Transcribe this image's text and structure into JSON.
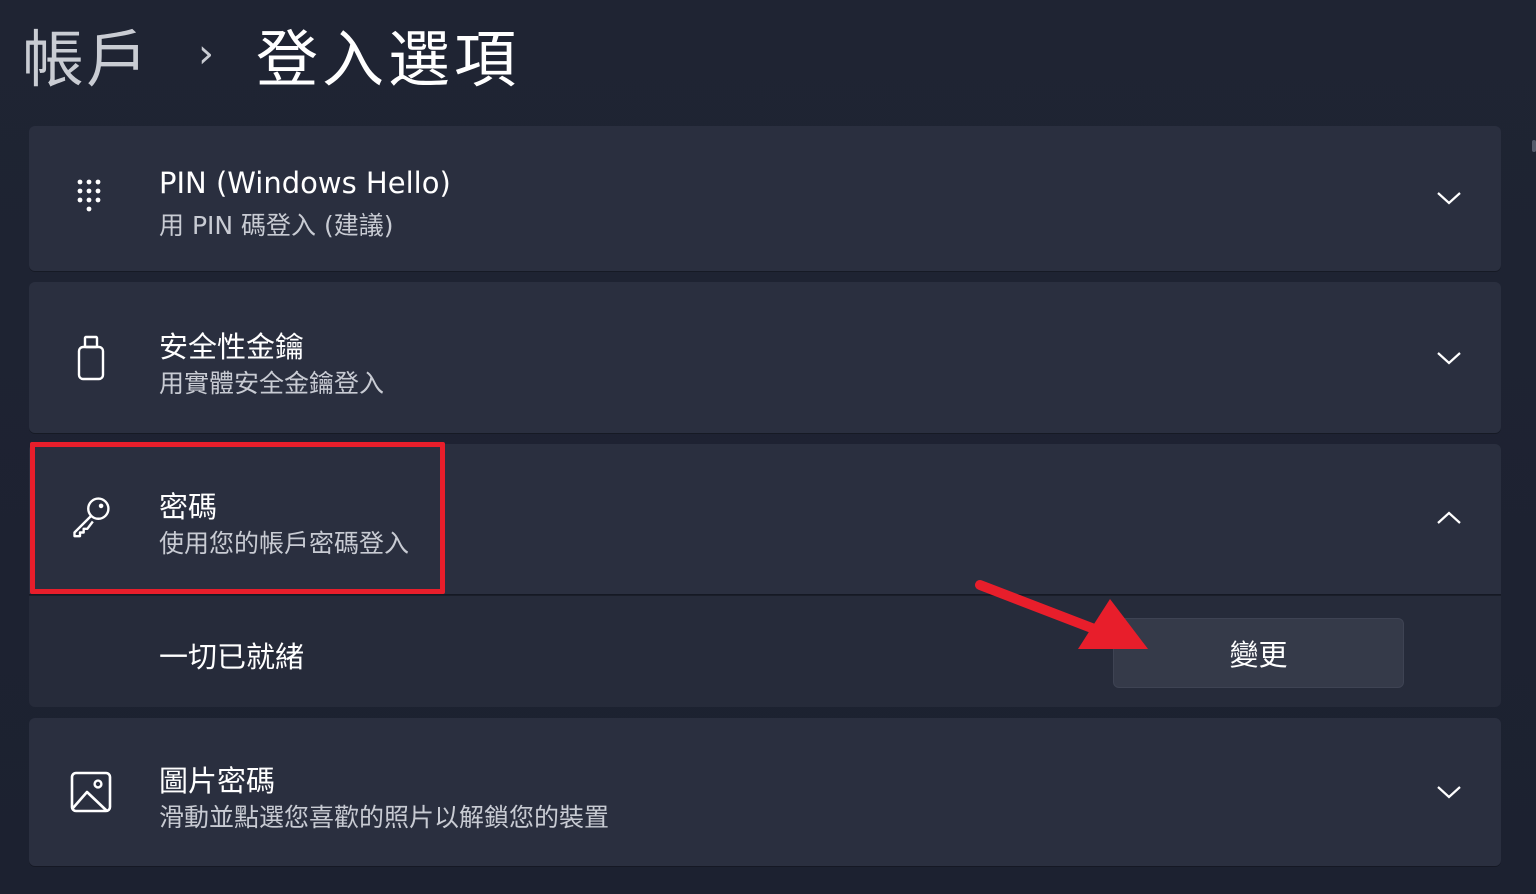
{
  "breadcrumb": {
    "parent": "帳戶",
    "separator": "›",
    "current": "登入選項"
  },
  "options": [
    {
      "title": "PIN (Windows Hello)",
      "subtitle": "用 PIN 碼登入 (建議)",
      "icon": "pin-keypad-icon",
      "expanded": false
    },
    {
      "title": "安全性金鑰",
      "subtitle": "用實體安全金鑰登入",
      "icon": "usb-key-icon",
      "expanded": false
    },
    {
      "title": "密碼",
      "subtitle": "使用您的帳戶密碼登入",
      "icon": "key-icon",
      "expanded": true,
      "status": "一切已就緒",
      "action_label": "變更"
    },
    {
      "title": "圖片密碼",
      "subtitle": "滑動並點選您喜歡的照片以解鎖您的裝置",
      "icon": "picture-icon",
      "expanded": false
    }
  ],
  "colors": {
    "background": "#1f2433",
    "card": "#2a2f3f",
    "highlight": "#e81e2b",
    "button": "#353a49"
  }
}
